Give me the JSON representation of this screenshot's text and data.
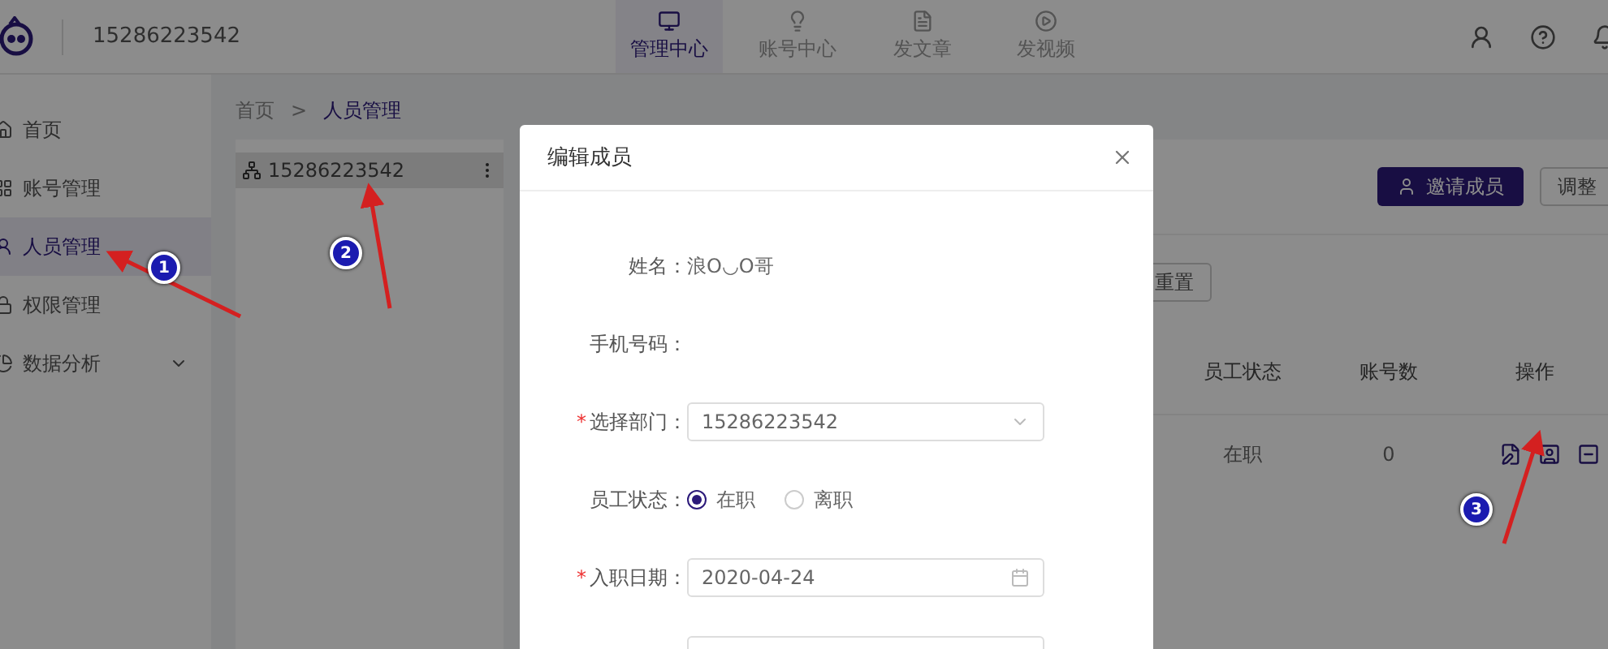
{
  "header": {
    "account": "15286223542",
    "tabs": [
      {
        "label": "管理中心",
        "selected": true
      },
      {
        "label": "账号中心",
        "selected": false
      },
      {
        "label": "发文章",
        "selected": false
      },
      {
        "label": "发视频",
        "selected": false
      }
    ]
  },
  "sidebar": {
    "items": [
      {
        "label": "首页",
        "selected": false
      },
      {
        "label": "账号管理",
        "selected": false
      },
      {
        "label": "人员管理",
        "selected": true
      },
      {
        "label": "权限管理",
        "selected": false
      },
      {
        "label": "数据分析",
        "selected": false,
        "expandable": true
      }
    ]
  },
  "breadcrumb": [
    "首页",
    ">",
    "人员管理"
  ],
  "department_tree": [
    {
      "label": "15286223542",
      "selected": true
    }
  ],
  "toolbar": {
    "buttons": [
      "邀请成员",
      "调整"
    ],
    "reset": "重置"
  },
  "table": {
    "columns": [
      "员工状态",
      "账号数",
      "操作"
    ],
    "rows": [
      {
        "status": "在职",
        "accounts": "0"
      }
    ]
  },
  "dialog": {
    "title": "编辑成员",
    "required_mark": "*",
    "fields": [
      {
        "kind": "text",
        "label": "姓名：",
        "value": "浪O◡O哥",
        "required": false
      },
      {
        "kind": "text",
        "label": "手机号码：",
        "required": false
      },
      {
        "kind": "select",
        "label": "选择部门：",
        "value": "15286223542",
        "required": true
      },
      {
        "kind": "radio",
        "label": "员工状态：",
        "options": [
          {
            "label": "在职",
            "selected": true
          },
          {
            "label": "离职",
            "selected": false
          }
        ],
        "required": false
      },
      {
        "kind": "date",
        "label": "入职日期：",
        "value": "2020-04-24",
        "required": true
      },
      {
        "kind": "tags"
      }
    ]
  },
  "annotations": [
    {
      "label": "1"
    },
    {
      "label": "2"
    },
    {
      "label": "3"
    }
  ]
}
